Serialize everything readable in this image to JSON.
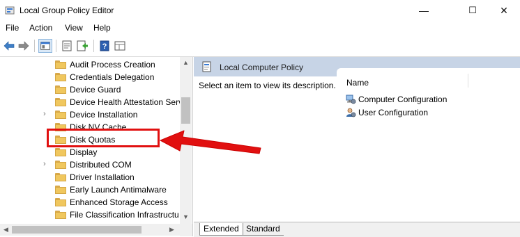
{
  "window": {
    "title": "Local Group Policy Editor",
    "controls": {
      "minimize": "—",
      "maximize": "☐",
      "close": "✕"
    }
  },
  "menu": [
    "File",
    "Action",
    "View",
    "Help"
  ],
  "toolbar": {
    "icons": [
      "back-arrow-icon",
      "forward-arrow-icon",
      "show-hide-console-tree-icon",
      "properties-icon",
      "export-list-icon",
      "help-icon",
      "extended-view-icon"
    ]
  },
  "tree": {
    "items": [
      {
        "label": "Audit Process Creation",
        "expandable": false
      },
      {
        "label": "Credentials Delegation",
        "expandable": false
      },
      {
        "label": "Device Guard",
        "expandable": false
      },
      {
        "label": "Device Health Attestation Serv",
        "expandable": false
      },
      {
        "label": "Device Installation",
        "expandable": true
      },
      {
        "label": "Disk NV Cache",
        "expandable": false
      },
      {
        "label": "Disk Quotas",
        "expandable": false
      },
      {
        "label": "Display",
        "expandable": false
      },
      {
        "label": "Distributed COM",
        "expandable": true
      },
      {
        "label": "Driver Installation",
        "expandable": false
      },
      {
        "label": "Early Launch Antimalware",
        "expandable": false
      },
      {
        "label": "Enhanced Storage Access",
        "expandable": false
      },
      {
        "label": "File Classification Infrastructu",
        "expandable": false
      }
    ],
    "expand_glyph": "›",
    "scroll_up": "▲",
    "scroll_down": "▼",
    "scroll_left": "◀",
    "scroll_right": "▶"
  },
  "right_pane": {
    "header_title": "Local Computer Policy",
    "description": "Select an item to view its description.",
    "column_header": "Name",
    "items": [
      {
        "label": "Computer Configuration",
        "icon": "computer-icon"
      },
      {
        "label": "User Configuration",
        "icon": "user-icon"
      }
    ]
  },
  "tabs": [
    "Extended",
    "Standard"
  ],
  "annotation": {
    "color": "#e11010",
    "target": "Disk Quotas"
  },
  "colors": {
    "header_bg": "#c7d4e6",
    "folder": "#f0c75e",
    "accent": "#2b6cb5"
  }
}
